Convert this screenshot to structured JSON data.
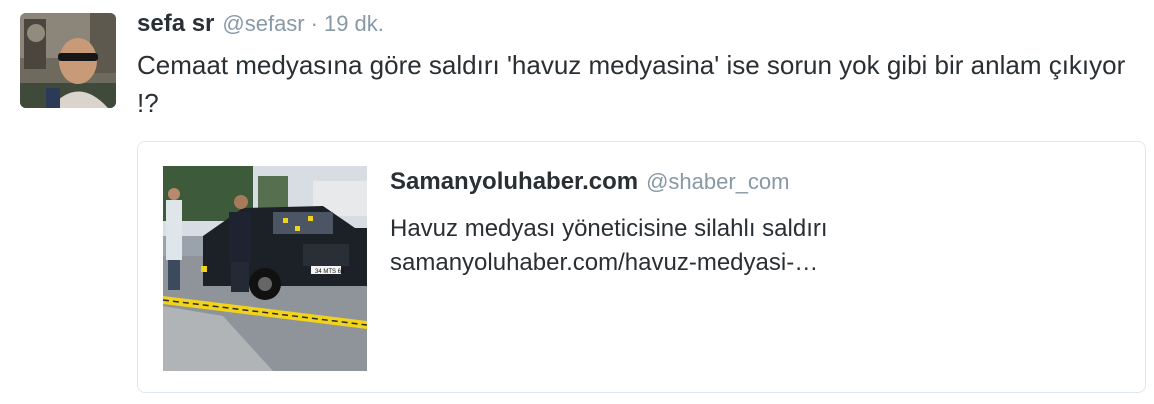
{
  "tweet": {
    "author_name": "sefa sr",
    "author_handle": "@sefasr",
    "separator": "·",
    "time": "19 dk.",
    "text": "Cemaat medyasına göre saldırı 'havuz medyasina' ise sorun yok gibi bir anlam çıkıyor !?"
  },
  "card": {
    "site_name": "Samanyoluhaber.com",
    "site_handle": "@shaber_com",
    "title": "Havuz medyası yöneticisine silahlı saldırı",
    "url": "samanyoluhaber.com/havuz-medyasi-…",
    "plate_text": "34 MTS 60"
  },
  "colors": {
    "text": "#292f33",
    "secondary": "#8899a6",
    "border": "#e1e8ed",
    "police_tape": "#f2d31b"
  }
}
